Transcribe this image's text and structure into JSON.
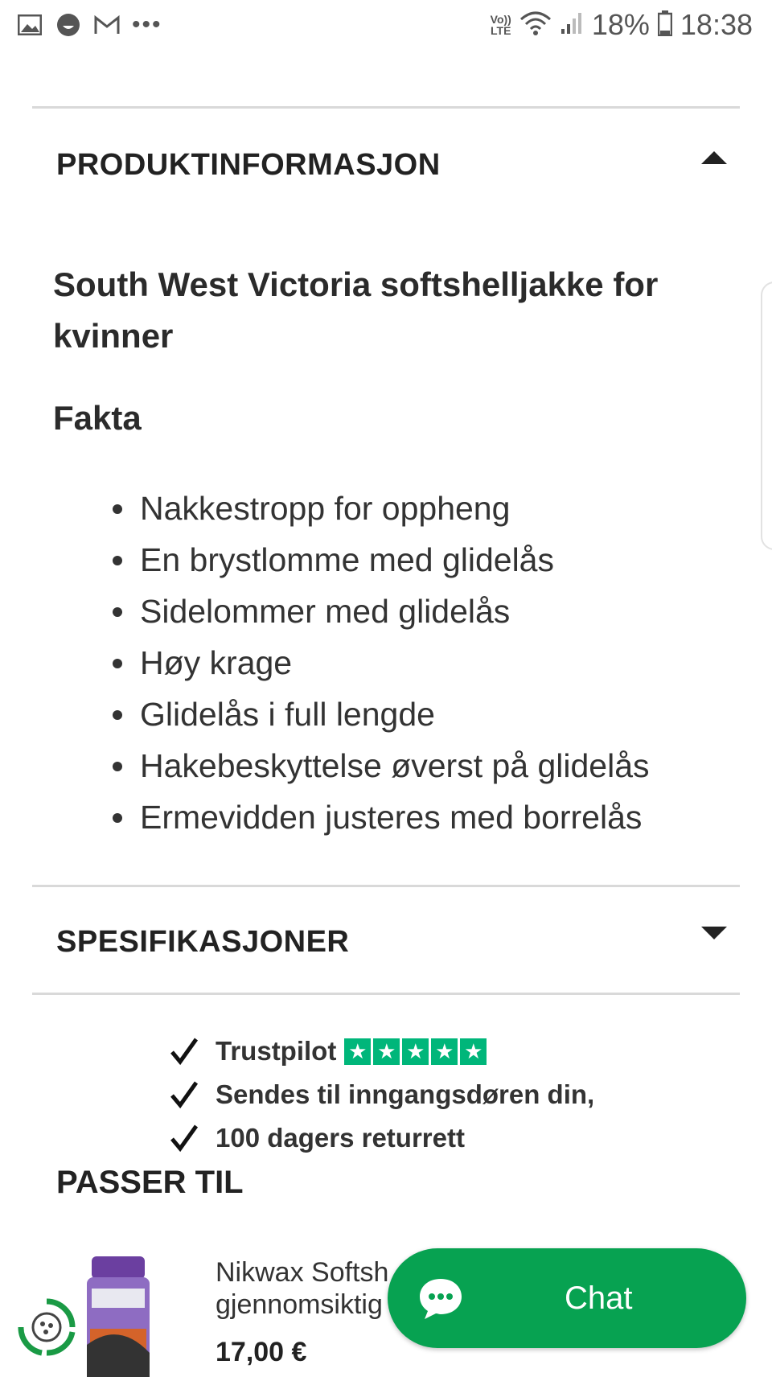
{
  "status_bar": {
    "volte": "Vo)) LTE",
    "battery": "18%",
    "time": "18:38",
    "left_icons": [
      "gallery-icon",
      "smiley-icon",
      "gmail-icon",
      "more-dots-icon"
    ],
    "right_icons": [
      "volte-icon",
      "wifi-icon",
      "signal-icon",
      "battery-icon"
    ]
  },
  "product_info": {
    "heading": "PRODUKTINFORMASJON",
    "product_title": "South West Victoria softshelljakke for kvinner",
    "fakta_heading": "Fakta",
    "features": [
      "Nakkestropp for oppheng",
      "En brystlomme med glidelås",
      "Sidelommer med glidelås",
      "Høy krage",
      "Glidelås i full lengde",
      "Hakebeskyttelse øverst på glidelås",
      "Ermevidden justeres med borrelås"
    ]
  },
  "specs": {
    "heading": "SPESIFIKASJONER"
  },
  "trust": {
    "items": [
      "Trustpilot",
      "Sendes til inngangsdøren din,",
      "100 dagers returrett"
    ],
    "trustpilot_stars": 5,
    "star_color": "#00b67a"
  },
  "passer_til": {
    "heading": "PASSER TIL",
    "product": {
      "name_line1": "Nikwax Softsh",
      "name_line2": "gjennomsiktig",
      "price": "17,00 €"
    }
  },
  "chat": {
    "label": "Chat",
    "color": "#07a251"
  }
}
